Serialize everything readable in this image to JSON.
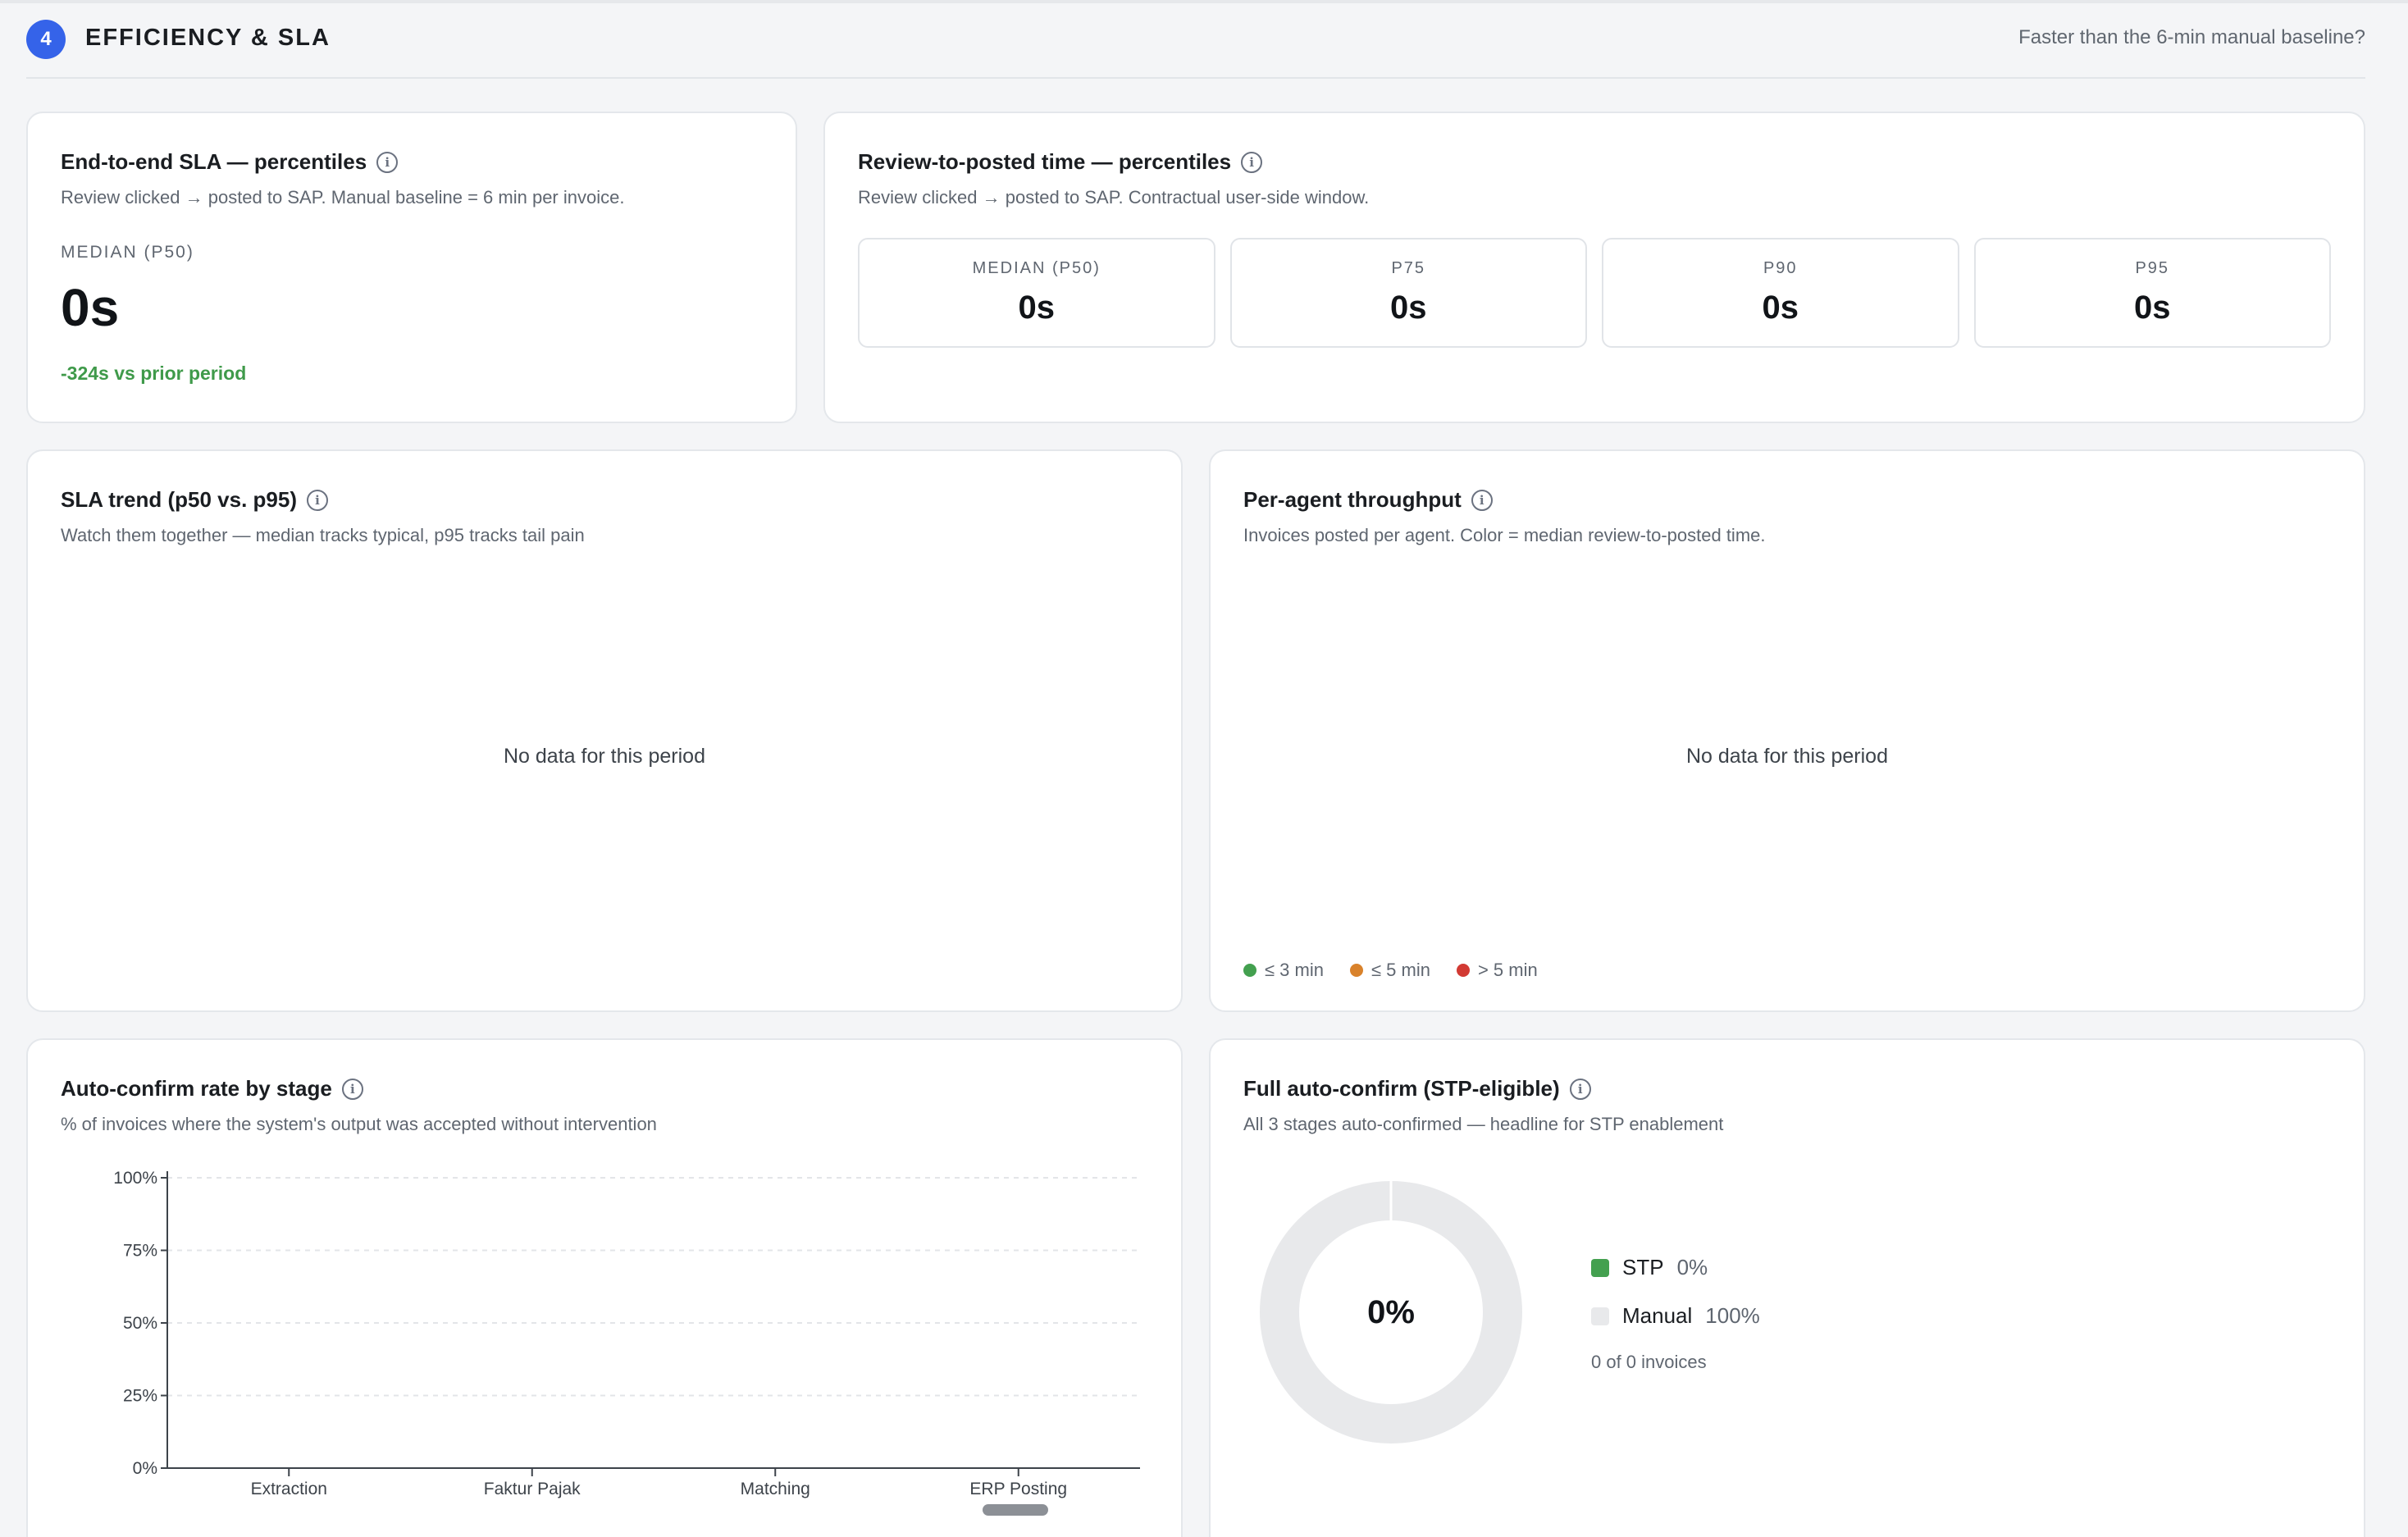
{
  "section": {
    "step": "4",
    "title": "EFFICIENCY & SLA",
    "hint": "Faster than the 6-min manual baseline?"
  },
  "e2e_sla": {
    "title": "End-to-end SLA — percentiles",
    "subtitle": "Review clicked → posted to SAP. Manual baseline = 6 min per invoice.",
    "kpi_label": "MEDIAN (P50)",
    "kpi_value": "0s",
    "delta": "-324s vs prior period",
    "delta_color": "#3f9a4a"
  },
  "review_posted": {
    "title": "Review-to-posted time — percentiles",
    "subtitle": "Review clicked → posted to SAP. Contractual user-side window.",
    "percentiles": [
      {
        "label": "MEDIAN (P50)",
        "value": "0s"
      },
      {
        "label": "P75",
        "value": "0s"
      },
      {
        "label": "P90",
        "value": "0s"
      },
      {
        "label": "P95",
        "value": "0s"
      }
    ]
  },
  "sla_trend": {
    "title": "SLA trend (p50 vs. p95)",
    "subtitle": "Watch them together — median tracks typical, p95 tracks tail pain",
    "empty": "No data for this period"
  },
  "throughput": {
    "title": "Per-agent throughput",
    "subtitle": "Invoices posted per agent. Color = median review-to-posted time.",
    "empty": "No data for this period",
    "legend": [
      {
        "label": "≤ 3 min",
        "color": "#43a04f"
      },
      {
        "label": "≤ 5 min",
        "color": "#d9822b"
      },
      {
        "label": "> 5 min",
        "color": "#d23a33"
      }
    ]
  },
  "auto_confirm": {
    "title": "Auto-confirm rate by stage",
    "subtitle": "% of invoices where the system's output was accepted without intervention"
  },
  "chart_data": {
    "type": "bar",
    "categories": [
      "Extraction",
      "Faktur Pajak",
      "Matching",
      "ERP Posting"
    ],
    "values": [
      null,
      null,
      null,
      null
    ],
    "yticks": [
      "0%",
      "25%",
      "50%",
      "75%",
      "100%"
    ],
    "ylim": [
      0,
      100
    ],
    "grid": true
  },
  "stp": {
    "title": "Full auto-confirm (STP-eligible)",
    "subtitle": "All 3 stages auto-confirmed — headline for STP enablement",
    "center": "0%",
    "stp_label": "STP",
    "stp_value": "0%",
    "stp_fraction": 0,
    "stp_color": "#43a04f",
    "manual_label": "Manual",
    "manual_value": "100%",
    "manual_color": "#e8e9eb",
    "footnote": "0 of 0 invoices"
  }
}
